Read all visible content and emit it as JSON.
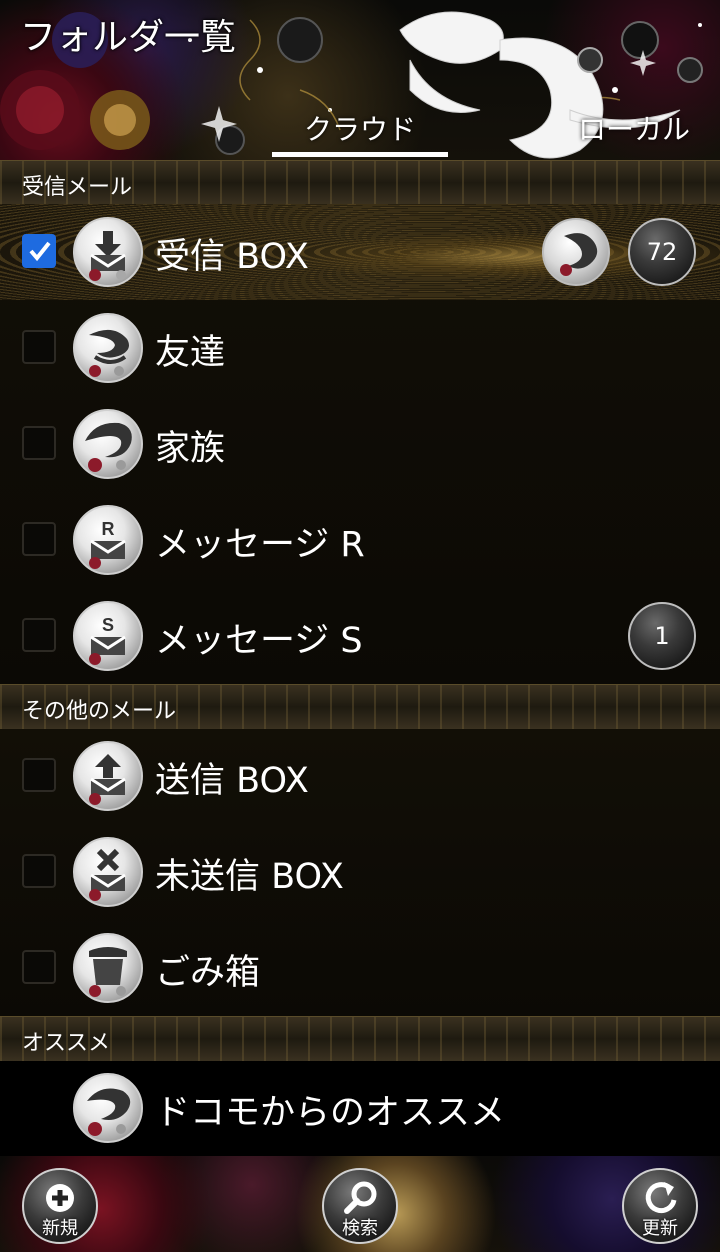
{
  "header": {
    "title": "フォルダ一覧",
    "tabs": [
      {
        "label": "クラウド",
        "selected": true
      },
      {
        "label": "ローカル",
        "selected": false
      }
    ]
  },
  "sections": [
    {
      "title": "受信メール",
      "rows": [
        {
          "label": "受信 BOX",
          "icon": "inbox-download-icon",
          "checked": true,
          "badges": [
            "",
            "72"
          ]
        },
        {
          "label": "友達",
          "icon": "dragon-icon",
          "checked": false
        },
        {
          "label": "家族",
          "icon": "dragon-icon",
          "checked": false
        },
        {
          "label": "メッセージ R",
          "icon": "message-r-icon",
          "checked": false
        },
        {
          "label": "メッセージ S",
          "icon": "message-s-icon",
          "checked": false,
          "badges": [
            "1"
          ]
        }
      ]
    },
    {
      "title": "その他のメール",
      "rows": [
        {
          "label": "送信 BOX",
          "icon": "outbox-upload-icon",
          "checked": false
        },
        {
          "label": "未送信 BOX",
          "icon": "unsent-x-icon",
          "checked": false
        },
        {
          "label": "ごみ箱",
          "icon": "trash-icon",
          "checked": false
        }
      ]
    },
    {
      "title": "オススメ",
      "rows": [
        {
          "label": "ドコモからのオススメ",
          "icon": "dragon-icon"
        }
      ]
    }
  ],
  "footer": {
    "new_label": "新規",
    "search_label": "検索",
    "refresh_label": "更新"
  },
  "colors": {
    "checkbox_checked": "#1e6be0",
    "tab_underline": "#ffffff",
    "section_band": "#3a3120"
  }
}
